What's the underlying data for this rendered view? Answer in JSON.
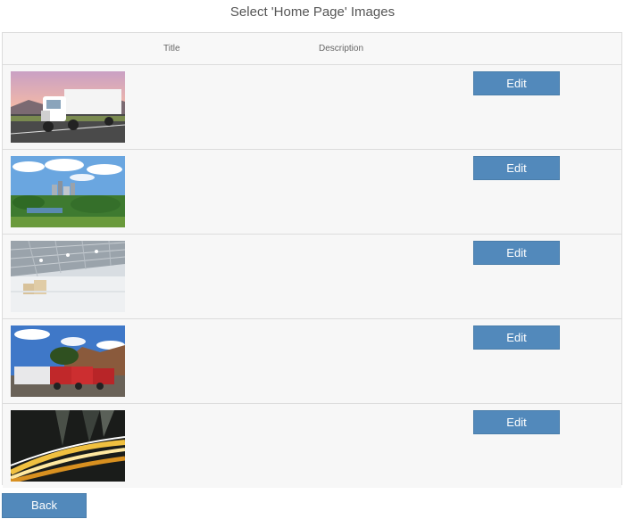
{
  "page": {
    "title": "Select 'Home Page' Images"
  },
  "table": {
    "headers": {
      "title": "Title",
      "description": "Description"
    },
    "rows": [
      {
        "image": "white-semi-truck-photo",
        "title": "",
        "description": "",
        "edit_label": "Edit"
      },
      {
        "image": "city-skyline-park-photo",
        "title": "",
        "description": "",
        "edit_label": "Edit"
      },
      {
        "image": "empty-warehouse-photo",
        "title": "",
        "description": "",
        "edit_label": "Edit"
      },
      {
        "image": "red-trucks-desert-photo",
        "title": "",
        "description": "",
        "edit_label": "Edit"
      },
      {
        "image": "city-light-trails-photo",
        "title": "",
        "description": "",
        "edit_label": "Edit"
      }
    ]
  },
  "footer": {
    "back_label": "Back"
  },
  "colors": {
    "button": "#5289bb",
    "row_bg": "#f7f7f7",
    "border": "#dcdcdc"
  }
}
